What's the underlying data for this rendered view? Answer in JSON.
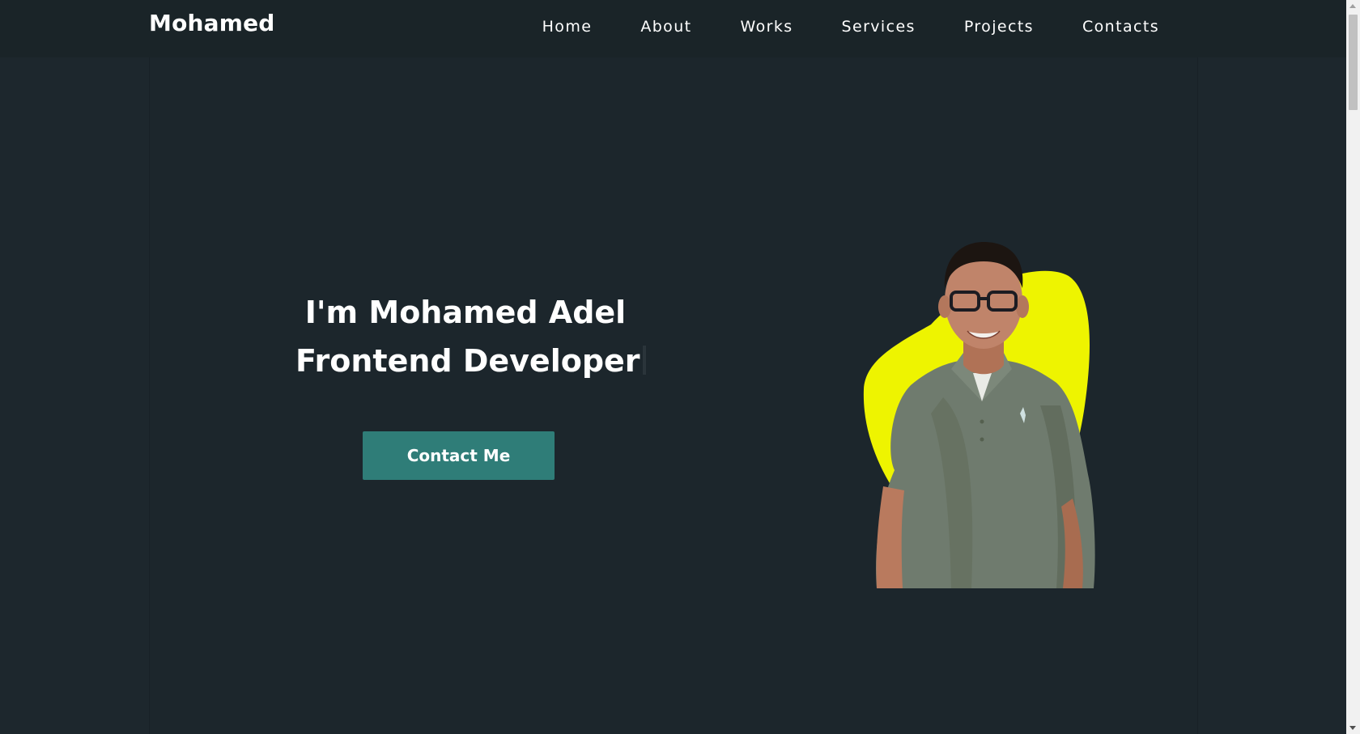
{
  "header": {
    "logo": "Mohamed",
    "nav": [
      {
        "label": "Home"
      },
      {
        "label": "About"
      },
      {
        "label": "Works"
      },
      {
        "label": "Services"
      },
      {
        "label": "Projects"
      },
      {
        "label": "Contacts"
      }
    ]
  },
  "hero": {
    "line1": "I'm Mohamed Adel",
    "line2": "Frontend Developer",
    "button": "Contact Me",
    "image": "portrait-photo"
  },
  "colors": {
    "background": "#1d272d",
    "button": "#2f7d78",
    "blob": "#eef400"
  }
}
